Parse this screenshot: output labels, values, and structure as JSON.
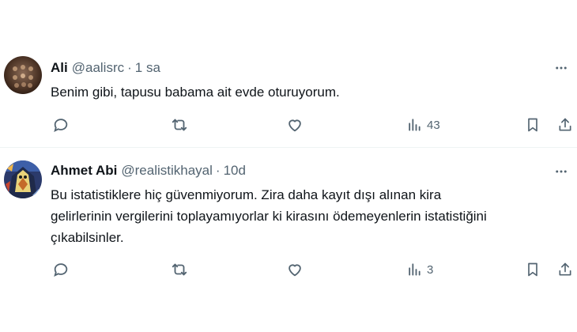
{
  "tweets": [
    {
      "display_name": "Ali",
      "handle": "@aalisrc",
      "separator": "·",
      "time": "1 sa",
      "text": "Benim gibi, tapusu babama ait evde oturuyorum.",
      "views": "43",
      "avatar_icon": "avatar-photo-icon"
    },
    {
      "display_name": "Ahmet Abi",
      "handle": "@realistikhayal",
      "separator": "·",
      "time": "10d",
      "text_lines": [
        "Bu istatistiklere hiç güvenmiyorum. Zira daha kayıt dışı alınan kira",
        "gelirlerinin vergilerini toplayamıyorlar ki kirasını ödemeyenlerin istatistiğini",
        "çıkabilsinler."
      ],
      "views": "3",
      "avatar_icon": "avatar-painting-icon"
    }
  ],
  "icons": {
    "more": "more-options-icon",
    "reply": "reply-icon",
    "retweet": "retweet-icon",
    "like": "like-icon",
    "views": "views-icon",
    "bookmark": "bookmark-icon",
    "share": "share-icon"
  },
  "colors": {
    "text": "#0f1419",
    "secondary": "#536471",
    "divider": "#eff3f4",
    "background": "#ffffff"
  }
}
